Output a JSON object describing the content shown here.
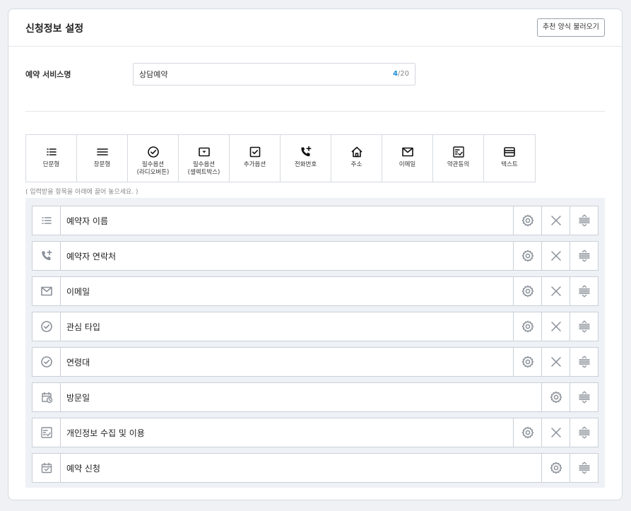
{
  "header": {
    "title": "신청정보 설정",
    "load_button": "추천 양식 불러오기"
  },
  "service": {
    "label": "예약 서비스명",
    "value": "상담예약",
    "count": "4",
    "max": "/20"
  },
  "palette": {
    "items": [
      {
        "label": "단문형",
        "icon": "short-text-icon"
      },
      {
        "label": "장문형",
        "icon": "long-text-icon"
      },
      {
        "label": "필수옵션\n(라디오버튼)",
        "icon": "radio-check-icon"
      },
      {
        "label": "필수옵션\n(셀렉트박스)",
        "icon": "select-box-icon"
      },
      {
        "label": "추가옵션",
        "icon": "checkbox-icon"
      },
      {
        "label": "전화번호",
        "icon": "phone-plus-icon"
      },
      {
        "label": "주소",
        "icon": "home-icon"
      },
      {
        "label": "이메일",
        "icon": "mail-icon"
      },
      {
        "label": "약관동의",
        "icon": "terms-check-icon"
      },
      {
        "label": "텍스트",
        "icon": "text-block-icon"
      }
    ],
    "hint": "( 입력받을 항목을 아래에 끌어 놓으세요. )"
  },
  "fields": [
    {
      "label": "예약자 이름",
      "icon": "short-text-icon",
      "deletable": true
    },
    {
      "label": "예약자 연락처",
      "icon": "phone-plus-icon",
      "deletable": true
    },
    {
      "label": "이메일",
      "icon": "mail-icon",
      "deletable": true
    },
    {
      "label": "관심 타입",
      "icon": "radio-check-icon",
      "deletable": true
    },
    {
      "label": "연령대",
      "icon": "radio-check-icon",
      "deletable": true
    },
    {
      "label": "방문일",
      "icon": "calendar-clock-icon",
      "deletable": false
    },
    {
      "label": "개인정보 수집 및 이용",
      "icon": "terms-check-icon",
      "deletable": true
    },
    {
      "label": "예약 신청",
      "icon": "calendar-check-icon",
      "deletable": false
    }
  ],
  "colors": {
    "accent": "#1d8fd6",
    "row_icon": "#8a9099",
    "palette_icon": "#111111"
  }
}
